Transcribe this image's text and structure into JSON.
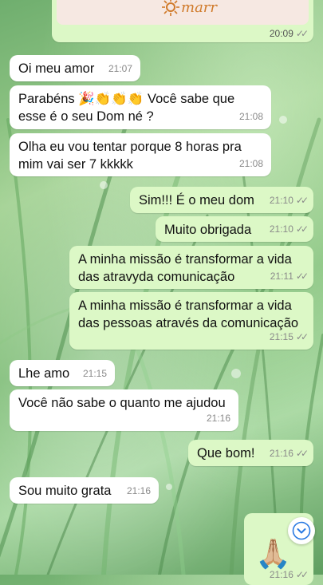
{
  "top_card": {
    "logo_text": "marr",
    "time": "20:09"
  },
  "messages": [
    {
      "id": "m1",
      "text": "Oi meu amor",
      "time": "21:07"
    },
    {
      "id": "m2",
      "text": "Parabéns 🎉👏👏👏 Você sabe que esse é o seu Dom né ?",
      "time": "21:08"
    },
    {
      "id": "m3",
      "text": "Olha eu vou tentar porque 8 horas pra mim vai ser 7 kkkkk",
      "time": "21:08"
    },
    {
      "id": "m4",
      "text": "Sim!!! É o meu dom",
      "time": "21:10"
    },
    {
      "id": "m5",
      "text": "Muito obrigada",
      "time": "21:10"
    },
    {
      "id": "m6",
      "text": "A minha missão é transformar a vida das atravyda comunicação",
      "time": "21:11"
    },
    {
      "id": "m7",
      "text": "A minha missão é transformar a vida das pessoas através da comunicação",
      "time": "21:15"
    },
    {
      "id": "m8",
      "text": "Lhe amo",
      "time": "21:15"
    },
    {
      "id": "m9",
      "text": "Você não sabe o quanto me ajudou",
      "time": "21:16"
    },
    {
      "id": "m10",
      "text": "Que bom!",
      "time": "21:16"
    },
    {
      "id": "m11",
      "text": "Sou muito grata",
      "time": "21:16"
    },
    {
      "id": "m12",
      "text": "🙏🏼",
      "time": "21:16"
    }
  ],
  "ticks": "✓✓",
  "icons": {
    "scroll": "chevron-down-icon",
    "tick": "double-check-icon"
  },
  "colors": {
    "incoming": "#ffffff",
    "outgoing": "#dcf8c6",
    "meta": "#8a8a8a",
    "accent": "#2a7ae2"
  }
}
